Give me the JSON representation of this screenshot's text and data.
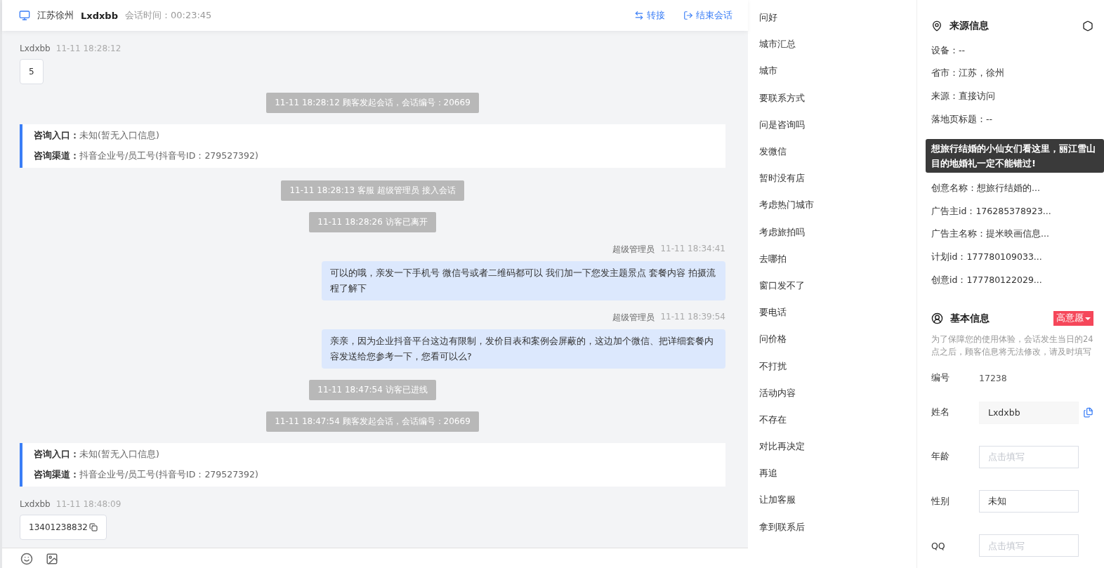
{
  "header": {
    "location": "江苏徐州",
    "visitor": "Lxdxbb",
    "duration": "会话时间：00:23:45",
    "actions": [
      {
        "kind": "transfer",
        "label": "转接"
      },
      {
        "kind": "end",
        "label": "结束会话"
      }
    ]
  },
  "messages": [
    {
      "kind": "visitor",
      "sender": "Lxdxbb",
      "time": "11-11 18:28:12",
      "text": "5",
      "copy": false
    },
    {
      "kind": "system",
      "text": "11-11 18:28:12 顾客发起会话，会话编号：20669"
    },
    {
      "kind": "info",
      "rows": [
        {
          "label": "咨询入口：",
          "value": "未知(暂无入口信息)"
        },
        {
          "label": "咨询渠道：",
          "value": "抖音企业号/员工号(抖音号ID：279527392)"
        }
      ]
    },
    {
      "kind": "system",
      "text": "11-11 18:28:13 客服 超级管理员 接入会话"
    },
    {
      "kind": "system",
      "text": "11-11 18:28:26 访客已离开"
    },
    {
      "kind": "agent",
      "sender": "超级管理员",
      "time": "11-11 18:34:41",
      "text": "可以的哦，亲发一下手机号 微信号或者二维码都可以 我们加一下您发主题景点 套餐内容 拍摄流程了解下"
    },
    {
      "kind": "agent",
      "sender": "超级管理员",
      "time": "11-11 18:39:54",
      "text": "亲亲，因为企业抖音平台这边有限制，发价目表和案例会屏蔽的，这边加个微信、把详细套餐内容发送给您参考一下，您看可以么?"
    },
    {
      "kind": "system",
      "text": "11-11 18:47:54 访客已进线"
    },
    {
      "kind": "system",
      "text": "11-11 18:47:54 顾客发起会话，会话编号：20669"
    },
    {
      "kind": "info",
      "rows": [
        {
          "label": "咨询入口：",
          "value": "未知(暂无入口信息)"
        },
        {
          "label": "咨询渠道：",
          "value": "抖音企业号/员工号(抖音号ID：279527392)"
        }
      ]
    },
    {
      "kind": "visitor",
      "sender": "Lxdxbb",
      "time": "11-11 18:48:09",
      "text": "13401238832",
      "copy": true
    }
  ],
  "phrases": [
    "问好",
    "城市汇总",
    "城市",
    "要联系方式",
    "问是咨询吗",
    "发微信",
    "暂时没有店",
    "考虑热门城市",
    "考虑旅拍吗",
    "去哪拍",
    "窗口发不了",
    "要电话",
    "问价格",
    "不打扰",
    "活动内容",
    "不存在",
    "对比再决定",
    "再追",
    "让加客服",
    "拿到联系后"
  ],
  "source": {
    "title": "来源信息",
    "rows": [
      "设备：--",
      "省市：江苏，徐州",
      "来源：直接访问",
      "落地页标题：--"
    ],
    "rows_below": [
      "创意名称：想旅行结婚的...",
      "广告主id：176285378923...",
      "广告主名称：提米映画信息...",
      "计划id：177780109033...",
      "创意id：177780122029..."
    ],
    "tooltip": "想旅行结婚的小仙女们看这里，丽江雪山目的地婚礼一定不能错过!"
  },
  "basic": {
    "title": "基本信息",
    "tag": "高意愿",
    "notice": "为了保障您的使用体验，会话发生当日的24点之后，顾客信息将无法修改，请及时填写",
    "fields": [
      {
        "kind": "text",
        "label": "编号",
        "value": "17238"
      },
      {
        "kind": "readonly",
        "label": "姓名",
        "value": "Lxdxbb"
      },
      {
        "kind": "input",
        "label": "年龄",
        "placeholder": "点击填写"
      },
      {
        "kind": "select",
        "label": "性别",
        "value": "未知"
      },
      {
        "kind": "input",
        "label": "QQ",
        "placeholder": "点击填写"
      }
    ]
  }
}
